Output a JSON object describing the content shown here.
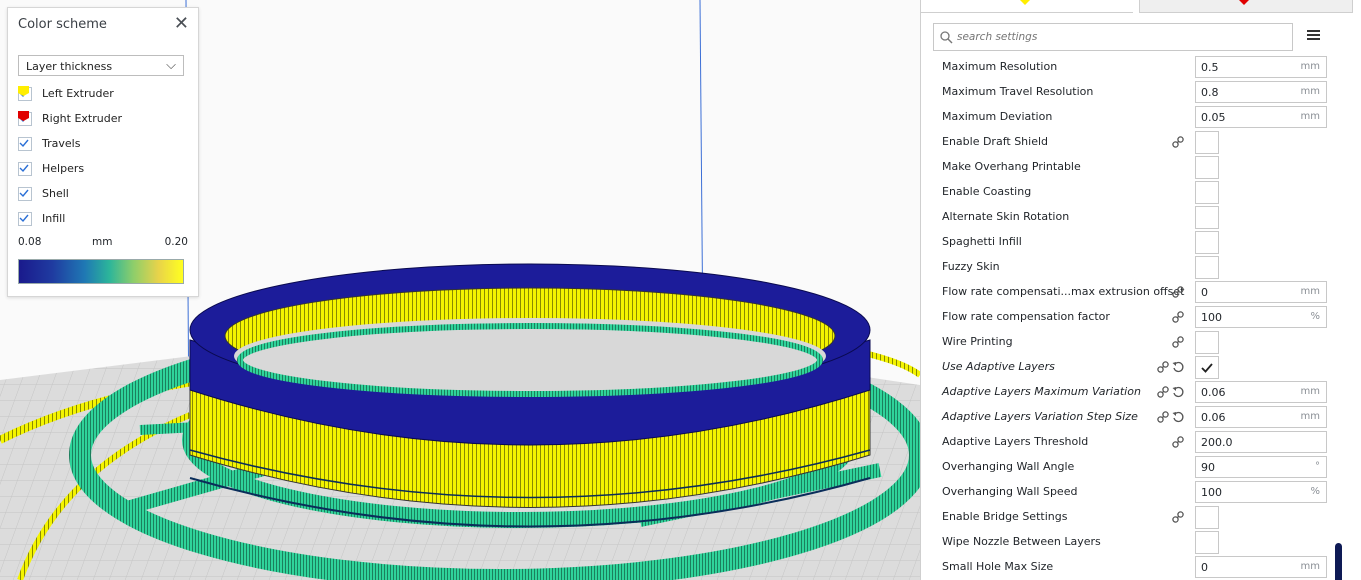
{
  "color_scheme": {
    "title": "Color scheme",
    "dropdown_value": "Layer thickness",
    "items": [
      {
        "label": "Left Extruder",
        "checked": true,
        "swatch": "#ffff00"
      },
      {
        "label": "Right Extruder",
        "checked": true,
        "swatch": "#ee0000"
      },
      {
        "label": "Travels",
        "checked": true
      },
      {
        "label": "Helpers",
        "checked": true
      },
      {
        "label": "Shell",
        "checked": true
      },
      {
        "label": "Infill",
        "checked": true
      }
    ],
    "legend": {
      "min": "0.08",
      "unit": "mm",
      "max": "0.20"
    }
  },
  "settings_panel": {
    "search_placeholder": "search settings",
    "colors": {
      "left_extruder": "#ffee00",
      "right_extruder": "#e00000",
      "accent": "#0e1a55"
    },
    "rows": [
      {
        "label": "Maximum Resolution",
        "type": "field",
        "value": "0.5",
        "unit": "mm"
      },
      {
        "label": "Maximum Travel Resolution",
        "type": "field",
        "value": "0.8",
        "unit": "mm"
      },
      {
        "label": "Maximum Deviation",
        "type": "field",
        "value": "0.05",
        "unit": "mm"
      },
      {
        "label": "Enable Draft Shield",
        "type": "check",
        "checked": false,
        "link": true
      },
      {
        "label": "Make Overhang Printable",
        "type": "check",
        "checked": false
      },
      {
        "label": "Enable Coasting",
        "type": "check",
        "checked": false
      },
      {
        "label": "Alternate Skin Rotation",
        "type": "check",
        "checked": false
      },
      {
        "label": "Spaghetti Infill",
        "type": "check",
        "checked": false
      },
      {
        "label": "Fuzzy Skin",
        "type": "check",
        "checked": false
      },
      {
        "label": "Flow rate compensati...max extrusion offset",
        "type": "field",
        "value": "0",
        "unit": "mm",
        "link": true
      },
      {
        "label": "Flow rate compensation factor",
        "type": "field",
        "value": "100",
        "unit": "%",
        "link": true
      },
      {
        "label": "Wire Printing",
        "type": "check",
        "checked": false,
        "link": true
      },
      {
        "label": "Use Adaptive Layers",
        "type": "check",
        "checked": true,
        "link": true,
        "reset": true,
        "italic": true
      },
      {
        "label": "Adaptive Layers Maximum Variation",
        "type": "field",
        "value": "0.06",
        "unit": "mm",
        "link": true,
        "reset": true,
        "italic": true
      },
      {
        "label": "Adaptive Layers Variation Step Size",
        "type": "field",
        "value": "0.06",
        "unit": "mm",
        "link": true,
        "reset": true,
        "italic": true
      },
      {
        "label": "Adaptive Layers Threshold",
        "type": "field",
        "value": "200.0",
        "unit": "",
        "link": true
      },
      {
        "label": "Overhanging Wall Angle",
        "type": "field",
        "value": "90",
        "unit": "°"
      },
      {
        "label": "Overhanging Wall Speed",
        "type": "field",
        "value": "100",
        "unit": "%"
      },
      {
        "label": "Enable Bridge Settings",
        "type": "check",
        "checked": false,
        "link": true
      },
      {
        "label": "Wipe Nozzle Between Layers",
        "type": "check",
        "checked": false
      },
      {
        "label": "Small Hole Max Size",
        "type": "field",
        "value": "0",
        "unit": "mm"
      }
    ]
  }
}
